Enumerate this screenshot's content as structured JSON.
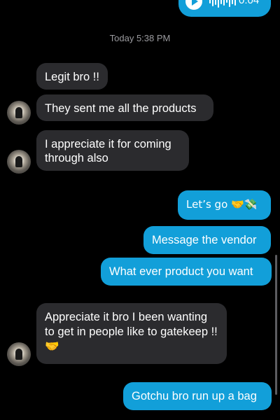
{
  "timestamp": "Today 5:38 PM",
  "audio": {
    "duration": "0:04"
  },
  "messages": [
    {
      "text": "Legit bro !!"
    },
    {
      "text": "They sent me all the products"
    },
    {
      "text": "I appreciate it for coming through also"
    },
    {
      "text": "Let’s go 🤝💸"
    },
    {
      "text": "Message the vendor"
    },
    {
      "text": "What ever product you want"
    },
    {
      "text": "Appreciate it  bro I been wanting to get in people like to gatekeep !!🤝"
    },
    {
      "text": "Gotchu bro run up a bag"
    }
  ],
  "colors": {
    "incoming": "#2b2b2e",
    "outgoing": "#129fd9",
    "background": "#000000"
  },
  "icons": [
    "play-icon",
    "waveform-icon",
    "avatar"
  ]
}
